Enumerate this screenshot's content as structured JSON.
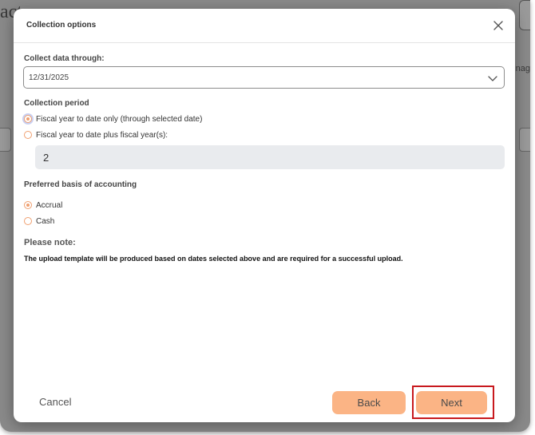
{
  "background": {
    "title_fragment": "act",
    "right_fragment": "nag"
  },
  "modal": {
    "title": "Collection options",
    "close_icon": "close-icon"
  },
  "collect_through": {
    "label": "Collect data through:",
    "value": "12/31/2025",
    "icon": "chevron-down-icon"
  },
  "collection_period": {
    "label": "Collection period",
    "options": [
      {
        "label": "Fiscal year to date only (through selected date)",
        "checked": true
      },
      {
        "label": "Fiscal year to date plus fiscal year(s):",
        "checked": false
      }
    ],
    "years_value": "2"
  },
  "accounting_basis": {
    "label": "Preferred basis of accounting",
    "options": [
      {
        "label": "Accrual",
        "checked": true
      },
      {
        "label": "Cash",
        "checked": false
      }
    ]
  },
  "note": {
    "title": "Please note:",
    "text": "The upload template will be produced based on dates selected above and are required for a successful upload."
  },
  "footer": {
    "cancel_label": "Cancel",
    "back_label": "Back",
    "next_label": "Next"
  },
  "colors": {
    "accent": "#fbb485",
    "radio_border": "#f0a070",
    "highlight": "#c8191e"
  }
}
